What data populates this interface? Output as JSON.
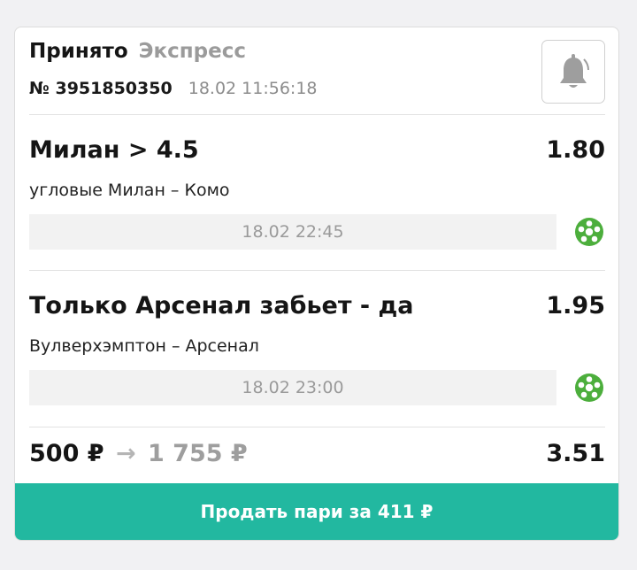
{
  "header": {
    "status": "Принято",
    "bet_type": "Экспресс",
    "number": "№ 3951850350",
    "placed_at": "18.02 11:56:18",
    "bell_icon": "bell-icon"
  },
  "bets": [
    {
      "title": "Милан > 4.5",
      "odds": "1.80",
      "match": "угловые Милан – Комо",
      "datetime": "18.02 22:45",
      "sport_icon": "football-icon"
    },
    {
      "title": "Только Арсенал забьет - да",
      "odds": "1.95",
      "match": "Вулверхэмптон – Арсенал",
      "datetime": "18.02 23:00",
      "sport_icon": "football-icon"
    }
  ],
  "summary": {
    "stake": "500 ₽",
    "arrow": "→",
    "payout": "1 755 ₽",
    "total_odds": "3.51"
  },
  "sell_button": {
    "label": "Продать пари за 411 ₽"
  },
  "colors": {
    "accent": "#22b8a0",
    "football_icon": "#4cae3c",
    "muted_text": "#9b9b9b"
  }
}
